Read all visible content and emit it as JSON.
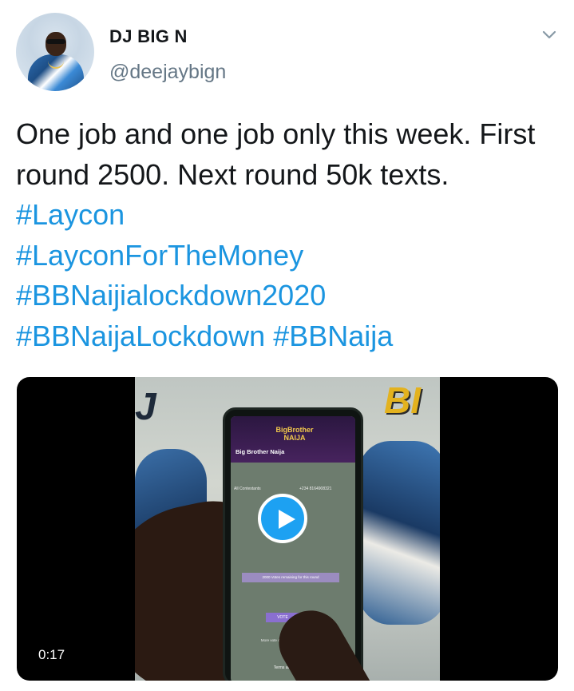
{
  "tweet": {
    "author_name": "DJ BIG N",
    "author_handle": "@deejaybign",
    "text_plain": "One job and one job only this week. First round 2500. Next round 50k texts.",
    "hashtags": [
      "#Laycon",
      "#LayconForTheMoney",
      "#BBNaijialockdown2020",
      "#BBNaijaLockdown",
      "#BBNaija"
    ]
  },
  "video": {
    "duration": "0:17",
    "frame_text": {
      "left_logo": "J",
      "right_logo": "BI",
      "brand": "BigBrother NAIJA",
      "app_title": "Big Brother Naija",
      "back_link": "All Contestants",
      "phone_number": "+234 8164908321",
      "votes_remaining": "2000 Votes remaining for this round",
      "vote_button": "VOTE",
      "more_options": "More vote options available. Learn more",
      "terms": "Terms and Conditions"
    }
  },
  "colors": {
    "link": "#1b95e0",
    "text": "#14171a",
    "handle": "#657786",
    "play_button": "#1da1f2"
  }
}
